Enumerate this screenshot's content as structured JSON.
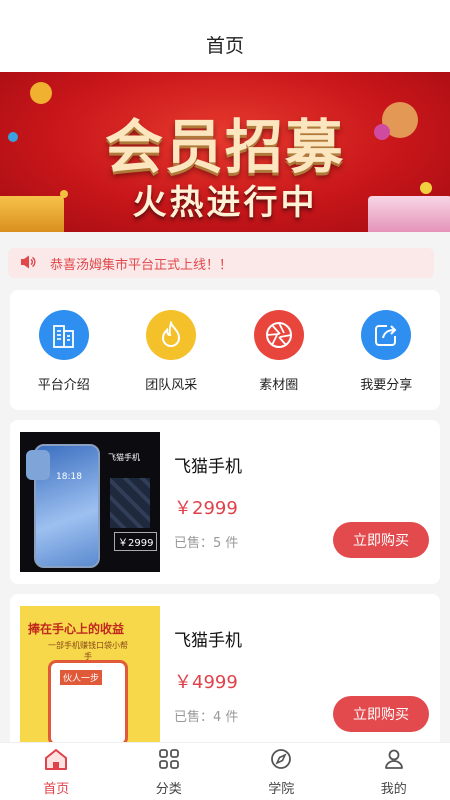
{
  "header": {
    "title": "首页"
  },
  "banner": {
    "title": "会员招募",
    "subtitle": "火热进行中"
  },
  "notice": {
    "icon": "speaker-icon",
    "text": "恭喜汤姆集市平台正式上线！！"
  },
  "quick_links": [
    {
      "label": "平台介绍",
      "icon": "building-icon",
      "color": "#2e8ff0"
    },
    {
      "label": "团队风采",
      "icon": "flame-icon",
      "color": "#f5c12a"
    },
    {
      "label": "素材圈",
      "icon": "aperture-icon",
      "color": "#e8453c"
    },
    {
      "label": "我要分享",
      "icon": "share-icon",
      "color": "#2e8ff0"
    }
  ],
  "products": [
    {
      "name": "飞猫手机",
      "price": "￥2999",
      "sold": "已售：5 件",
      "buy_label": "立即购买",
      "thumb": {
        "badge": "飞猫手机",
        "screen_time": "18:18",
        "price_tag": "￥2999"
      }
    },
    {
      "name": "飞猫手机",
      "price": "￥4999",
      "sold": "已售：4 件",
      "buy_label": "立即购买",
      "thumb": {
        "headline": "捧在手心上的收益",
        "sub": "一部手机赚钱口袋小帮手",
        "badge": "伙人一步"
      }
    }
  ],
  "tabbar": [
    {
      "label": "首页",
      "icon": "home-icon",
      "active": true
    },
    {
      "label": "分类",
      "icon": "grid-icon",
      "active": false
    },
    {
      "label": "学院",
      "icon": "compass-icon",
      "active": false
    },
    {
      "label": "我的",
      "icon": "user-icon",
      "active": false
    }
  ],
  "colors": {
    "accent": "#e0424b",
    "button": "#e34a4e",
    "notice_bg": "#fbe9e9"
  }
}
